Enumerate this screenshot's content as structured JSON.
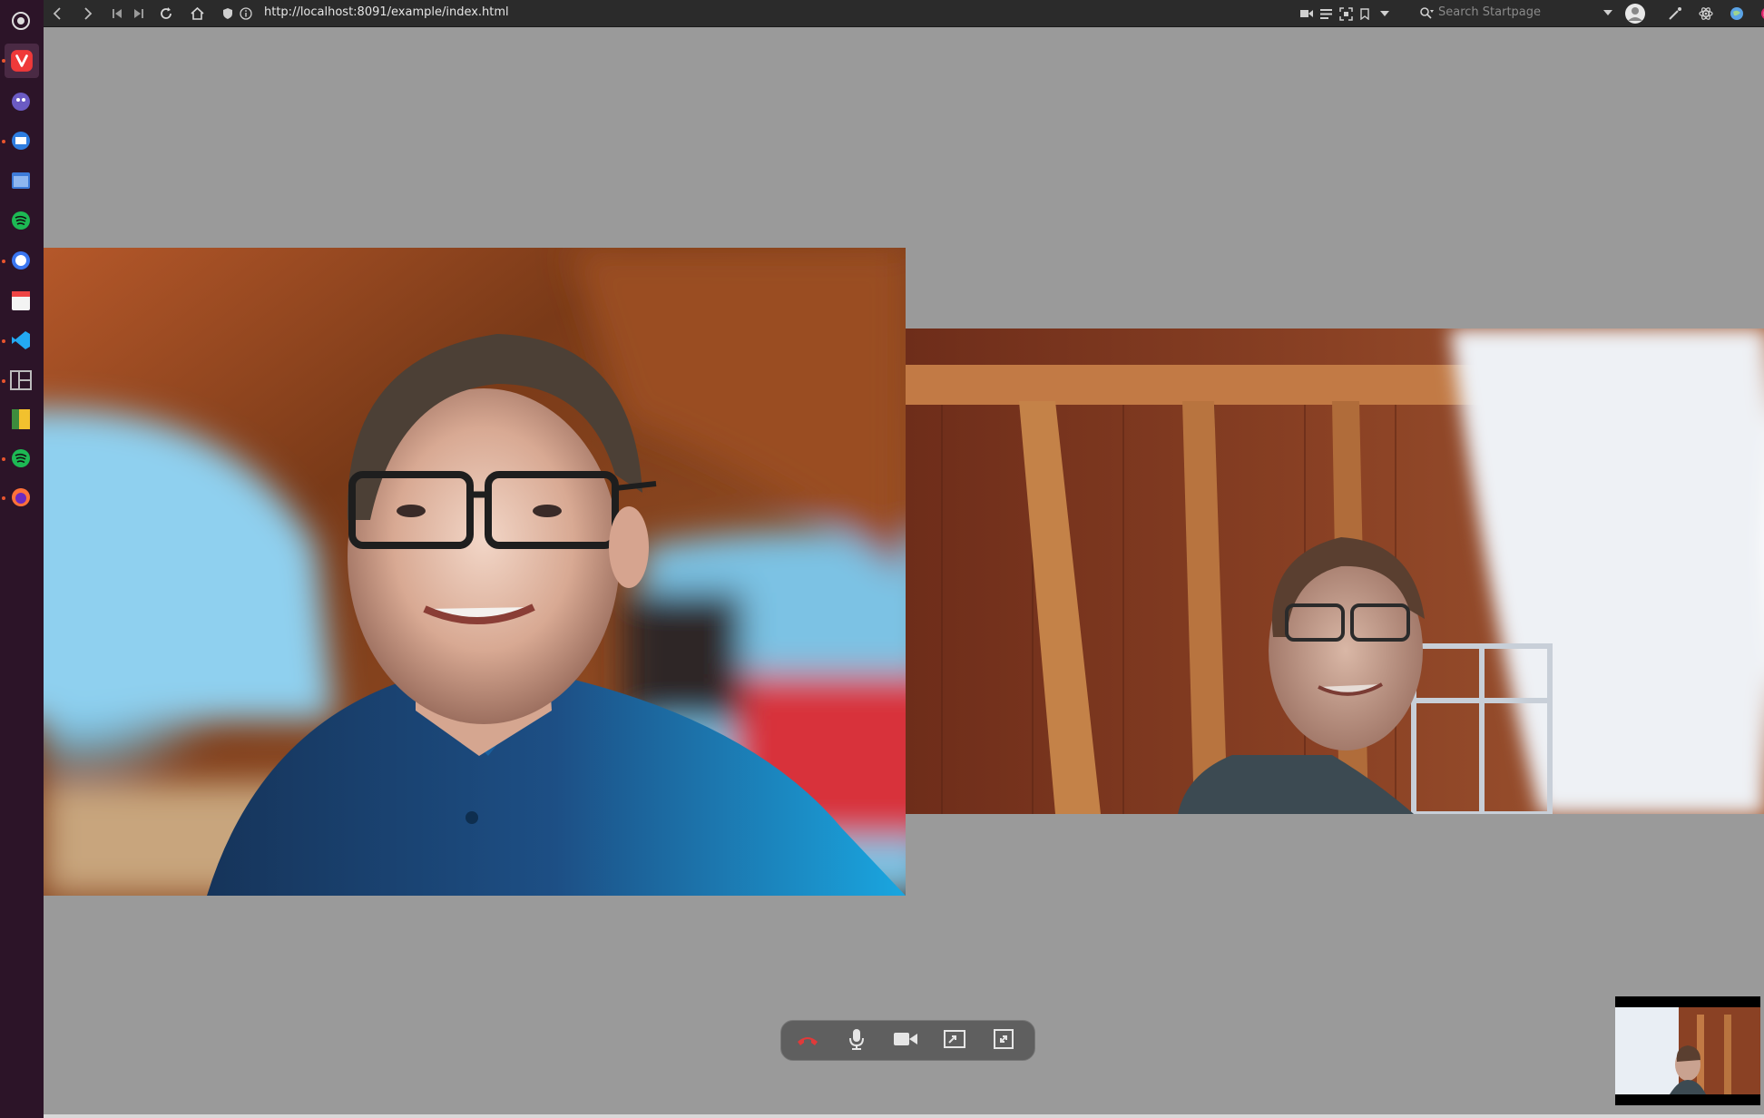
{
  "browser": {
    "url": "http://localhost:8091/example/index.html",
    "search_placeholder": "Search Startpage",
    "accent_color": "#2b2b2b"
  },
  "dock": {
    "items": [
      {
        "name": "vivaldi",
        "color": "#ef3939"
      },
      {
        "name": "ghost-app",
        "color": "#7b6bd3"
      },
      {
        "name": "thunderbird",
        "color": "#2e7de0"
      },
      {
        "name": "window-app",
        "color": "#3d7bd8"
      },
      {
        "name": "spotify",
        "color": "#1db954"
      },
      {
        "name": "signal",
        "color": "#3a76f0"
      },
      {
        "name": "calendar",
        "color": "#e44"
      },
      {
        "name": "vscode",
        "color": "#23a9f2"
      },
      {
        "name": "layout-app",
        "color": "#9aa"
      },
      {
        "name": "notes-app",
        "color": "#f2c12e"
      },
      {
        "name": "spotify-2",
        "color": "#1db954"
      },
      {
        "name": "firefox",
        "color": "#ff7139"
      }
    ]
  },
  "call": {
    "controls": [
      {
        "name": "hangup-button",
        "icon": "phone-hangup-icon"
      },
      {
        "name": "mute-button",
        "icon": "microphone-icon"
      },
      {
        "name": "camera-button",
        "icon": "video-camera-icon"
      },
      {
        "name": "screen-share-button",
        "icon": "screen-share-icon"
      },
      {
        "name": "fullscreen-button",
        "icon": "fullscreen-exit-icon"
      }
    ],
    "hangup_color": "#e03a3a",
    "panel_color": "#5f5f5f"
  }
}
